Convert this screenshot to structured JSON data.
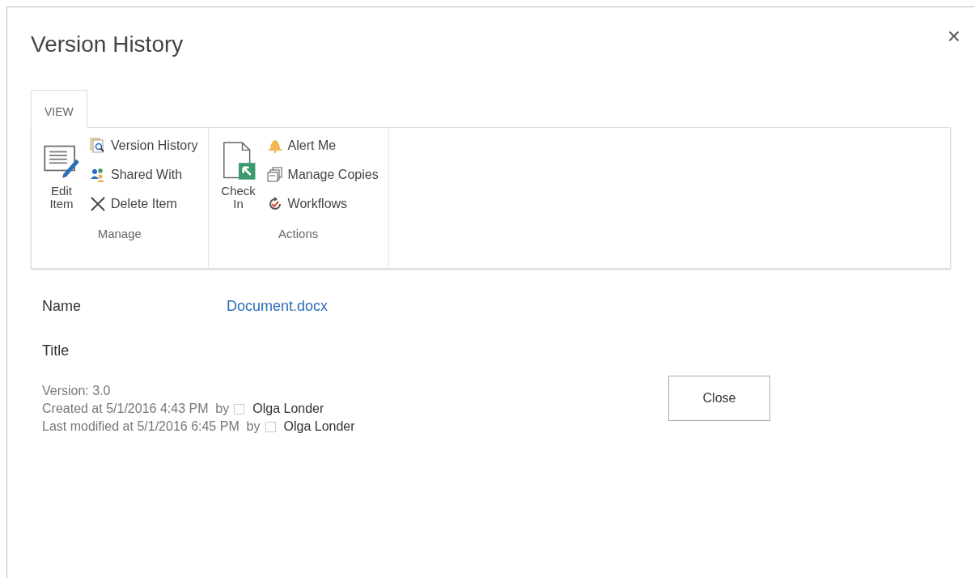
{
  "dialog": {
    "title": "Version History",
    "close": "×"
  },
  "tabs": [
    {
      "label": "VIEW",
      "selected": true
    }
  ],
  "ribbon": {
    "groups": [
      {
        "label": "Manage",
        "large": {
          "label": "Edit\nItem"
        },
        "items": [
          {
            "label": "Version History"
          },
          {
            "label": "Shared With"
          },
          {
            "label": "Delete Item"
          }
        ]
      },
      {
        "label": "Actions",
        "large": {
          "label": "Check\nIn"
        },
        "items": [
          {
            "label": "Alert Me"
          },
          {
            "label": "Manage Copies"
          },
          {
            "label": "Workflows"
          }
        ]
      }
    ]
  },
  "fields": [
    {
      "label": "Name",
      "value": "Document.docx"
    },
    {
      "label": "Title"
    }
  ],
  "version": "Version: 3.0",
  "history": [
    {
      "text": "Created at 5/1/2016 4:43 PM  by",
      "user": "Olga Londer"
    },
    {
      "text": "Last modified at 5/1/2016 6:45 PM  by",
      "user": "Olga Londer"
    }
  ],
  "buttons": [
    "Close"
  ]
}
